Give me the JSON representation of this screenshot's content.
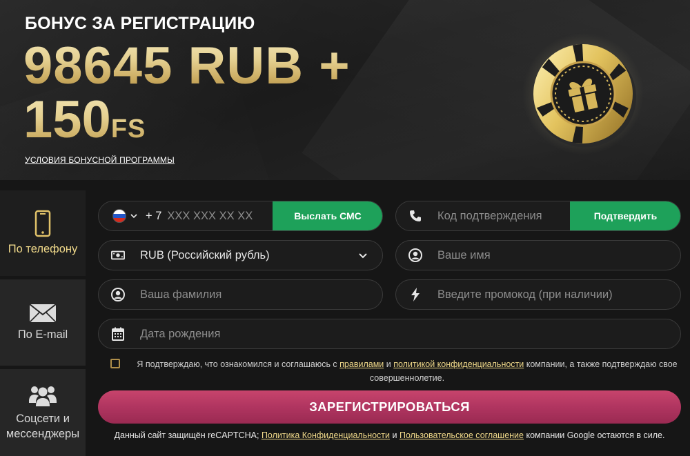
{
  "banner": {
    "subtitle": "БОНУС ЗА РЕГИСТРАЦИЮ",
    "amount_line1": "98645 RUB +",
    "amount_line2_number": "150",
    "amount_line2_suffix": "FS",
    "terms_link": "УСЛОВИЯ БОНУСНОЙ ПРОГРАММЫ",
    "chip_icon": "gift-chip-icon"
  },
  "tabs": [
    {
      "label": "По телефону",
      "icon": "smartphone-icon",
      "active": true
    },
    {
      "label": "По E-mail",
      "icon": "envelope-icon",
      "active": false
    },
    {
      "label": "Соцсети и мессенджеры",
      "label_line1": "Соцсети и",
      "label_line2": "мессенджеры",
      "icon": "users-icon",
      "active": false
    }
  ],
  "form": {
    "phone": {
      "prefix": "+ 7",
      "placeholder": "XXX XXX XX XX",
      "button": "Выслать СМС",
      "flag_icon": "russia-flag-icon"
    },
    "code": {
      "placeholder": "Код подтверждения",
      "button": "Подтвердить",
      "icon": "phone-handset-icon"
    },
    "currency": {
      "value": "RUB (Российский рубль)",
      "icon": "banknote-icon"
    },
    "first_name": {
      "placeholder": "Ваше имя",
      "icon": "user-circle-icon"
    },
    "last_name": {
      "placeholder": "Ваша фамилия",
      "icon": "user-circle-icon"
    },
    "promo": {
      "placeholder": "Введите промокод (при наличии)",
      "icon": "lightning-icon"
    },
    "birthdate": {
      "placeholder": "Дата рождения",
      "icon": "calendar-icon"
    },
    "consent": {
      "pre": "Я подтверждаю, что ознакомился и соглашаюсь с ",
      "rules_link": "правилами",
      "and": " и ",
      "privacy_link": "политикой конфиденциальности",
      "post_line1": " компании, а также подтверждаю свое",
      "post_line2": "совершеннолетие."
    },
    "register_button": "ЗАРЕГИСТРИРОВАТЬСЯ",
    "footer": {
      "pre": "Данный сайт защищён reCAPTCHA; ",
      "privacy_link": "Политика Конфиденциальности",
      "and": " и ",
      "terms_link": "Пользовательское соглашение",
      "post": " компании Google остаются в силе."
    }
  },
  "colors": {
    "gold": "#e4cf8f",
    "green": "#1ea15a",
    "register": "#b03560",
    "background": "#161616"
  }
}
